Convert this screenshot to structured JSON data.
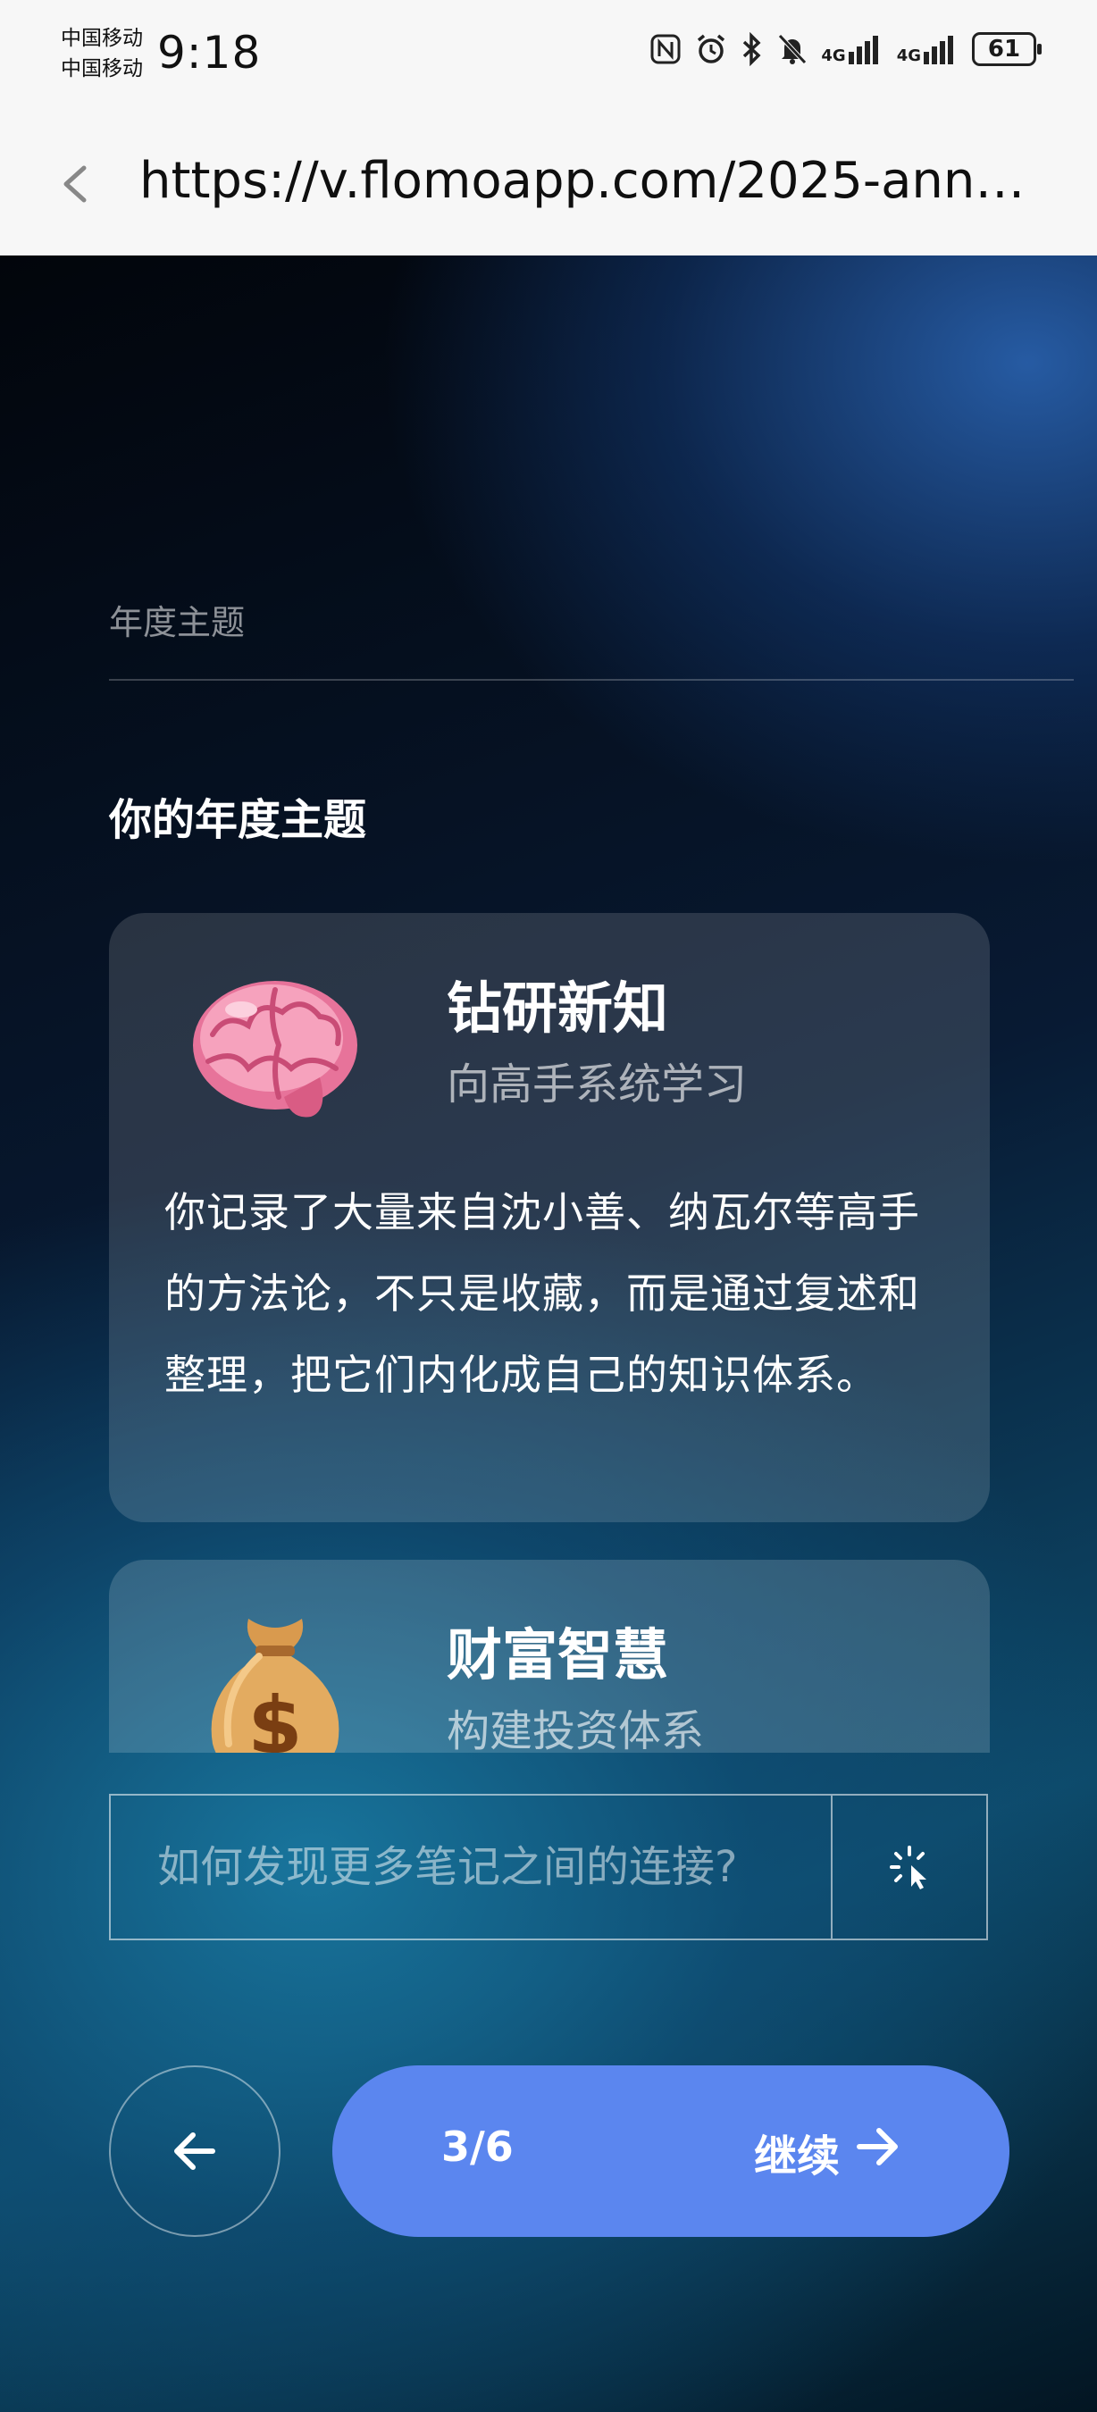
{
  "status_bar": {
    "carrier_1": "中国移动",
    "carrier_2": "中国移动",
    "time": "9:18",
    "network_1": "4G",
    "network_2": "4G",
    "battery": "61"
  },
  "browser": {
    "url": "https://v.flomoapp.com/2025-annu..."
  },
  "page": {
    "section_label": "年度主题",
    "heading": "你的年度主题",
    "themes": [
      {
        "emoji": "brain",
        "title": "钻研新知",
        "subtitle": "向高手系统学习",
        "description": "你记录了大量来自沈小善、纳瓦尔等高手的方法论，不只是收藏，而是通过复述和整理，把它们内化成自己的知识体系。"
      },
      {
        "emoji": "money-bag",
        "title": "财富智慧",
        "subtitle": "构建投资体系"
      }
    ],
    "ask": {
      "placeholder": "如何发现更多笔记之间的连接?"
    },
    "navigation": {
      "progress": "3/6",
      "continue_label": "继续"
    }
  },
  "colors": {
    "accent_button": "#5b86ef",
    "status_bar_bg": "#f7f7f7"
  }
}
